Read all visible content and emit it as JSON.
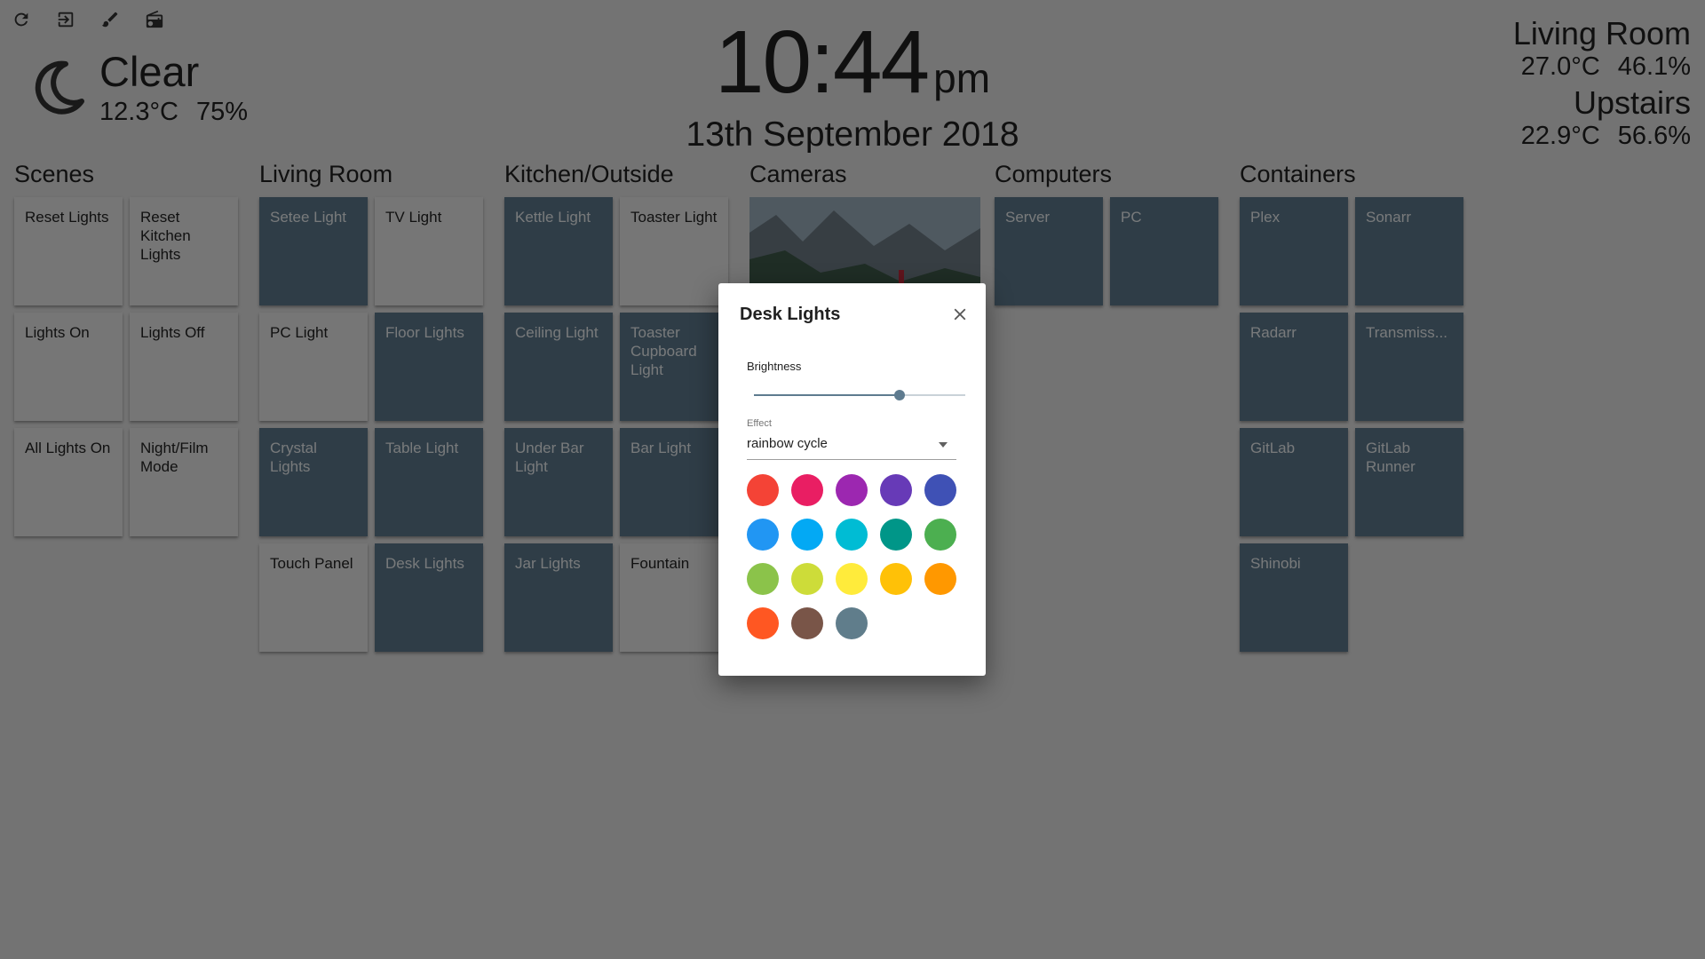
{
  "toolbar": {
    "icons": [
      "refresh-icon",
      "exit-icon",
      "brush-icon",
      "radio-icon"
    ]
  },
  "weather": {
    "condition": "Clear",
    "temperature": "12.3°C",
    "humidity": "75%",
    "icon": "moon-icon"
  },
  "clock": {
    "time": "10:44",
    "ampm": "pm",
    "date": "13th September 2018"
  },
  "sensors": [
    {
      "name": "Living Room",
      "temperature": "27.0°C",
      "humidity": "46.1%"
    },
    {
      "name": "Upstairs",
      "temperature": "22.9°C",
      "humidity": "56.6%"
    }
  ],
  "groups": [
    {
      "title": "Scenes",
      "tiles": [
        {
          "label": "Reset Lights",
          "state": "off"
        },
        {
          "label": "Reset Kitchen Lights",
          "state": "off"
        },
        {
          "label": "Lights On",
          "state": "off"
        },
        {
          "label": "Lights Off",
          "state": "off"
        },
        {
          "label": "All Lights On",
          "state": "off"
        },
        {
          "label": "Night/Film Mode",
          "state": "off"
        }
      ]
    },
    {
      "title": "Living Room",
      "tiles": [
        {
          "label": "Setee Light",
          "state": "on"
        },
        {
          "label": "TV Light",
          "state": "off"
        },
        {
          "label": "PC Light",
          "state": "off"
        },
        {
          "label": "Floor Lights",
          "state": "on"
        },
        {
          "label": "Crystal Lights",
          "state": "on"
        },
        {
          "label": "Table Light",
          "state": "on"
        },
        {
          "label": "Touch Panel",
          "state": "off"
        },
        {
          "label": "Desk Lights",
          "state": "on"
        }
      ]
    },
    {
      "title": "Kitchen/Outside",
      "tiles": [
        {
          "label": "Kettle Light",
          "state": "on"
        },
        {
          "label": "Toaster Light",
          "state": "off"
        },
        {
          "label": "Ceiling Light",
          "state": "on"
        },
        {
          "label": "Toaster Cupboard Light",
          "state": "on"
        },
        {
          "label": "Under Bar Light",
          "state": "on"
        },
        {
          "label": "Bar Light",
          "state": "on"
        },
        {
          "label": "Jar Lights",
          "state": "on"
        },
        {
          "label": "Fountain",
          "state": "off"
        }
      ]
    },
    {
      "title": "Cameras",
      "tiles": []
    },
    {
      "title": "Computers",
      "tiles": [
        {
          "label": "Server",
          "state": "on"
        },
        {
          "label": "PC",
          "state": "on"
        }
      ]
    },
    {
      "title": "Containers",
      "tiles": [
        {
          "label": "Plex",
          "state": "on"
        },
        {
          "label": "Sonarr",
          "state": "on"
        },
        {
          "label": "Radarr",
          "state": "on"
        },
        {
          "label": "Transmiss...",
          "state": "on"
        },
        {
          "label": "GitLab",
          "state": "on"
        },
        {
          "label": "GitLab Runner",
          "state": "on"
        },
        {
          "label": "Shinobi",
          "state": "on"
        }
      ]
    }
  ],
  "dialog": {
    "title": "Desk Lights",
    "brightness_label": "Brightness",
    "brightness_fraction": 0.69,
    "effect_label": "Effect",
    "effect_value": "rainbow cycle",
    "swatches": [
      "#f44336",
      "#e91e63",
      "#9c27b0",
      "#673ab7",
      "#3f51b5",
      "#2196f3",
      "#03a9f4",
      "#00bcd4",
      "#009688",
      "#4caf50",
      "#8bc34a",
      "#cddc39",
      "#ffeb3b",
      "#ffc107",
      "#ff9800",
      "#ff5722",
      "#795548",
      "#607d8b"
    ]
  }
}
